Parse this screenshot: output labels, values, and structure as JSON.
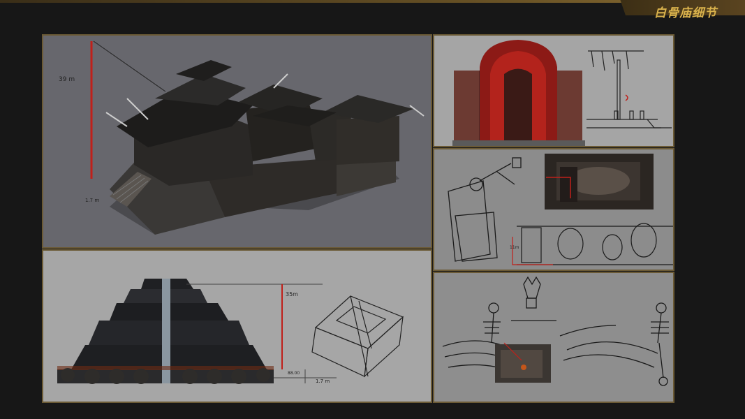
{
  "header": {
    "title": "白骨庙细节",
    "accent_color": "#d9b24c"
  },
  "panels": {
    "temple_overview": {
      "height_label": "39 m",
      "base_label": "1.7 m"
    },
    "pyramid_elevation": {
      "height_label": "35m",
      "base_label": "88.00",
      "step_label": "1.7 m"
    },
    "red_gate": {},
    "skeleton_statue": {
      "height_label": "11m"
    },
    "skeleton_bridge": {}
  },
  "colors": {
    "background": "#171717",
    "panel_border": "#6b5a35",
    "measure_red": "#c0201a"
  }
}
